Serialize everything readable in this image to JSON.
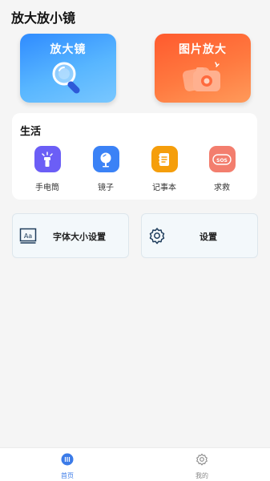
{
  "app": {
    "title": "放大放小镜"
  },
  "hero": {
    "magnifier_label": "放大镜",
    "image_zoom_label": "图片放大"
  },
  "life": {
    "title": "生活",
    "items": [
      {
        "label": "手电筒",
        "icon": "flashlight-icon",
        "color": "#6b5ef6"
      },
      {
        "label": "镜子",
        "icon": "mirror-icon",
        "color": "#3b82f6"
      },
      {
        "label": "记事本",
        "icon": "notebook-icon",
        "color": "#f59e0b"
      },
      {
        "label": "求救",
        "icon": "sos-icon",
        "color": "#f37e6e"
      }
    ]
  },
  "settings": {
    "font_size_label": "字体大小设置",
    "settings_label": "设置"
  },
  "tabbar": {
    "home_label": "首页",
    "mine_label": "我的",
    "active_color": "#3b7be8",
    "inactive_color": "#888888"
  }
}
